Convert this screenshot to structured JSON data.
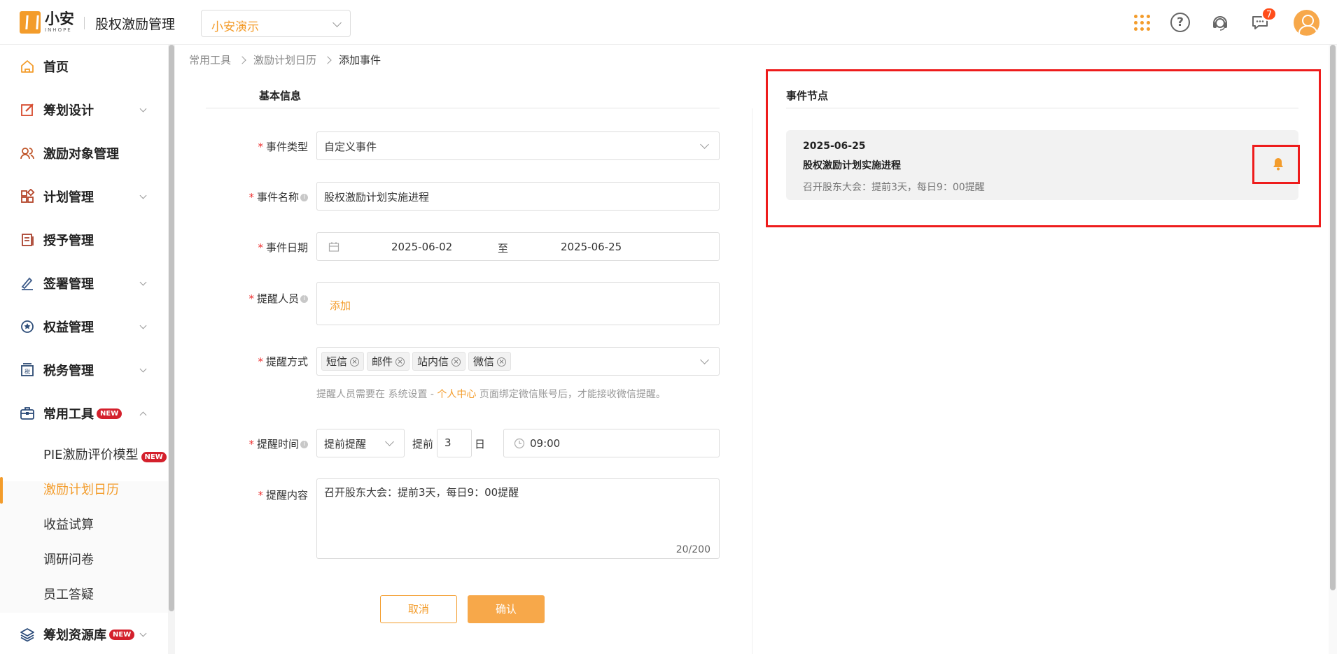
{
  "header": {
    "logo_name": "小安",
    "logo_sub": "INHOPE",
    "app_title": "股权激励管理",
    "company": "小安演示",
    "message_count": "7"
  },
  "sidebar": {
    "items": [
      {
        "label": "首页"
      },
      {
        "label": "筹划设计"
      },
      {
        "label": "激励对象管理"
      },
      {
        "label": "计划管理"
      },
      {
        "label": "授予管理"
      },
      {
        "label": "签署管理"
      },
      {
        "label": "权益管理"
      },
      {
        "label": "税务管理"
      },
      {
        "label": "常用工具",
        "badge": "NEW"
      },
      {
        "label": "筹划资源库",
        "badge": "NEW"
      }
    ],
    "sub_items": [
      {
        "label": "PIE激励评价模型",
        "badge": "NEW"
      },
      {
        "label": "激励计划日历"
      },
      {
        "label": "收益试算"
      },
      {
        "label": "调研问卷"
      },
      {
        "label": "员工答疑"
      }
    ]
  },
  "breadcrumb": [
    "常用工具",
    "激励计划日历",
    "添加事件"
  ],
  "form": {
    "section_title": "基本信息",
    "event_type": {
      "label": "事件类型",
      "value": "自定义事件"
    },
    "event_name": {
      "label": "事件名称",
      "value": "股权激励计划实施进程"
    },
    "event_date": {
      "label": "事件日期",
      "start": "2025-06-02",
      "separator": "至",
      "end": "2025-06-25"
    },
    "remind_person": {
      "label": "提醒人员",
      "add": "添加"
    },
    "remind_method": {
      "label": "提醒方式",
      "tags": [
        "短信",
        "邮件",
        "站内信",
        "微信"
      ]
    },
    "hint": {
      "pre": "提醒人员需要在 系统设置 - ",
      "link": "个人中心",
      "post": " 页面绑定微信账号后，才能接收微信提醒。"
    },
    "remind_time": {
      "label": "提醒时间",
      "mode": "提前提醒",
      "ahead": "提前",
      "days": "3",
      "unit": "日",
      "time": "09:00"
    },
    "remind_content": {
      "label": "提醒内容",
      "value": "召开股东大会：提前3天，每日9：00提醒",
      "counter": "20/200"
    },
    "cancel": "取消",
    "confirm": "确认"
  },
  "events": {
    "section_title": "事件节点",
    "card": {
      "date": "2025-06-25",
      "name": "股权激励计划实施进程",
      "desc": "召开股东大会：提前3天，每日9：00提醒"
    }
  },
  "colors": {
    "accent": "#f39c2b",
    "highlight": "#ee1c1c",
    "new_badge": "#d4202c"
  }
}
